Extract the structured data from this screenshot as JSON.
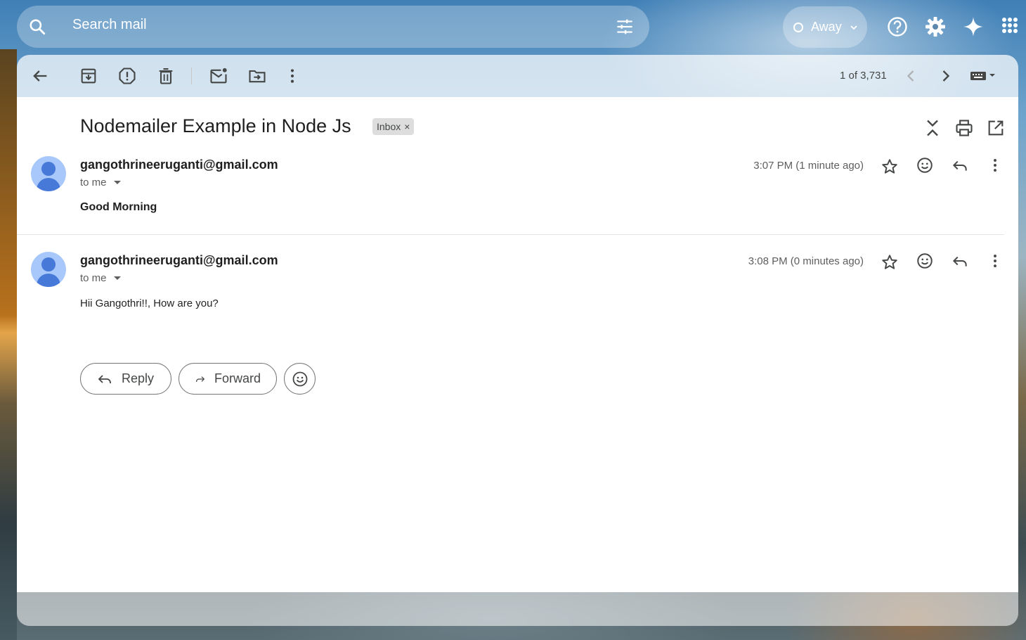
{
  "search": {
    "placeholder": "Search mail"
  },
  "status": {
    "label": "Away"
  },
  "toolbar": {
    "count": "1 of 3,731"
  },
  "thread": {
    "subject": "Nodemailer Example in Node Js",
    "label_chip": "Inbox",
    "chip_close": "×"
  },
  "messages": [
    {
      "sender": "gangothrineeruganti@gmail.com",
      "to": "to me",
      "time": "3:07 PM (1 minute ago)",
      "body": "Good Morning"
    },
    {
      "sender": "gangothrineeruganti@gmail.com",
      "to": "to me",
      "time": "3:08 PM (0 minutes ago)",
      "body": "Hii Gangothri!!, How are you?"
    }
  ],
  "actions": {
    "reply": "Reply",
    "forward": "Forward"
  },
  "icons": {
    "accent": "#0b57d0",
    "avatar_bg": "#a8c7fa",
    "avatar_fg": "#4679d8"
  }
}
